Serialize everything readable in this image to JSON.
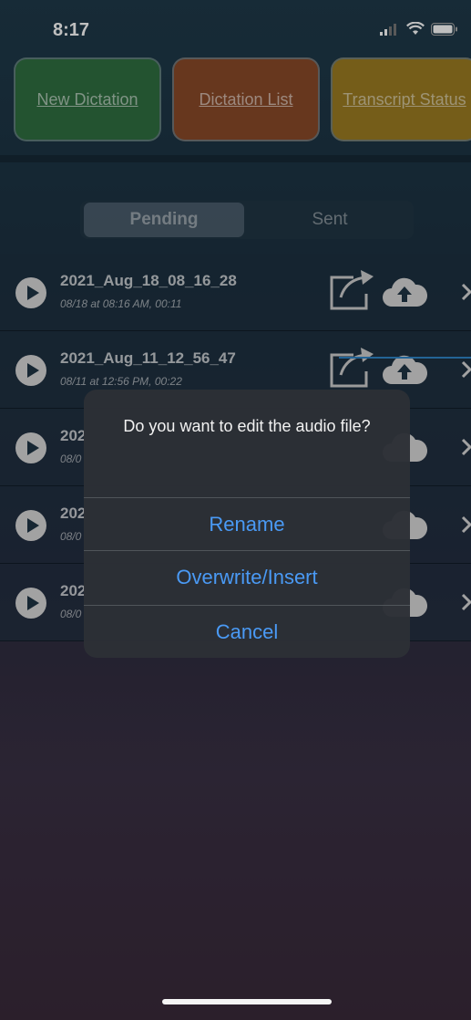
{
  "status_bar": {
    "time": "8:17"
  },
  "nav": {
    "new_dictation": "New Dictation",
    "dictation_list": "Dictation List",
    "transcript_status": "Transcript Status"
  },
  "tabs": {
    "pending": "Pending",
    "sent": "Sent",
    "selected": "Pending"
  },
  "recordings": [
    {
      "title": "2021_Aug_18_08_16_28",
      "subtitle": "08/18 at 08:16 AM, 00:11"
    },
    {
      "title": "2021_Aug_11_12_56_47",
      "subtitle": "08/11 at 12:56 PM, 00:22"
    },
    {
      "title": "202",
      "subtitle": "08/0"
    },
    {
      "title": "202",
      "subtitle": "08/0"
    },
    {
      "title": "202",
      "subtitle": "08/0"
    }
  ],
  "dialog": {
    "message": "Do you want to edit the audio file?",
    "rename": "Rename",
    "overwrite_insert": "Overwrite/Insert",
    "cancel": "Cancel"
  },
  "colors": {
    "new_dictation": "#2f6f40",
    "dictation_list": "#8a4a28",
    "transcript_status": "#9c7d22",
    "dialog_action": "#4a9af5"
  }
}
